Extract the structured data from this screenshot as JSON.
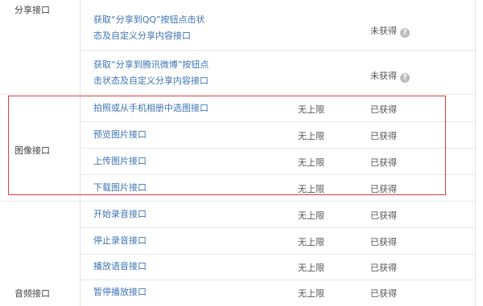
{
  "categories": [
    {
      "label": "分享接口"
    },
    {
      "label": "图像接口"
    },
    {
      "label": "音频接口"
    }
  ],
  "share_rows": [
    {
      "line1": "获取“分享到QQ”按钮点击状",
      "line2": "态及自定义分享内容接口",
      "status": "未获得",
      "help": "?"
    },
    {
      "line1": "获取“分享到腾讯微博”按钮点",
      "line2": "击状态及自定义分享内容接口",
      "status": "未获得",
      "help": "?"
    }
  ],
  "image_rows": [
    {
      "name": "拍照或从手机相册中选图接口",
      "limit": "无上限",
      "status": "已获得"
    },
    {
      "name": "预览图片接口",
      "limit": "无上限",
      "status": "已获得"
    },
    {
      "name": "上传图片接口",
      "limit": "无上限",
      "status": "已获得"
    },
    {
      "name": "下载图片接口",
      "limit": "无上限",
      "status": "已获得"
    }
  ],
  "audio_rows": [
    {
      "name": "开始录音接口",
      "limit": "无上限",
      "status": "已获得"
    },
    {
      "name": "停止录音接口",
      "limit": "无上限",
      "status": "已获得"
    },
    {
      "name": "播放语音接口",
      "limit": "无上限",
      "status": "已获得"
    },
    {
      "name": "暂停播放接口",
      "limit": "无上限",
      "status": "已获得"
    }
  ],
  "colors": {
    "link": "#3d74b3",
    "highlight": "#e23b3b",
    "border": "#e6e6e6"
  }
}
